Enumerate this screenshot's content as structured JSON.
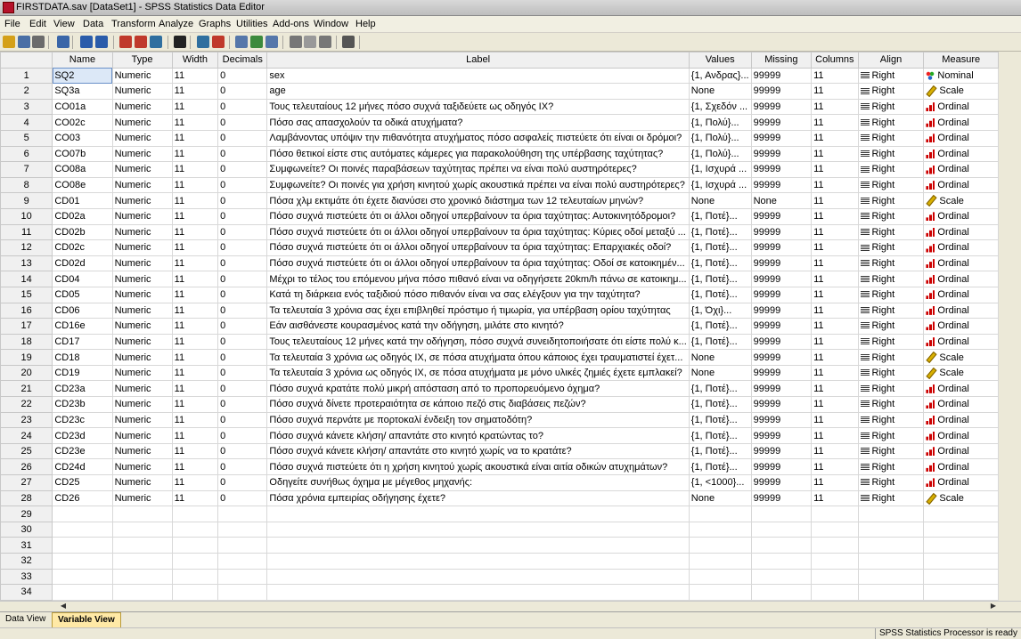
{
  "window": {
    "title": "FIRSTDATA.sav [DataSet1] - SPSS Statistics Data Editor"
  },
  "menu": [
    "File",
    "Edit",
    "View",
    "Data",
    "Transform",
    "Analyze",
    "Graphs",
    "Utilities",
    "Add-ons",
    "Window",
    "Help"
  ],
  "toolbar": [
    "open-icon",
    "save-icon",
    "print-icon",
    "dialog-recall-icon",
    "undo-icon",
    "redo-icon",
    "goto-case-icon",
    "goto-variable-icon",
    "variables-icon",
    "find-icon",
    "insert-cases-icon",
    "insert-variable-icon",
    "split-file-icon",
    "weight-cases-icon",
    "select-cases-icon",
    "value-labels-icon",
    "use-sets-icon",
    "show-all-icon",
    "spell-check-icon"
  ],
  "columns": [
    "Name",
    "Type",
    "Width",
    "Decimals",
    "Label",
    "Values",
    "Missing",
    "Columns",
    "Align",
    "Measure"
  ],
  "rows": [
    [
      "SQ2",
      "Numeric",
      "11",
      "0",
      "sex",
      "{1, Ανδρας}...",
      "99999",
      "11",
      "Right",
      "Nominal"
    ],
    [
      "SQ3a",
      "Numeric",
      "11",
      "0",
      "age",
      "None",
      "99999",
      "11",
      "Right",
      "Scale"
    ],
    [
      "CO01a",
      "Numeric",
      "11",
      "0",
      "Τους τελευταίους 12 μήνες πόσο συχνά ταξιδεύετε ως οδηγός IX?",
      "{1, Σχεδόν ...",
      "99999",
      "11",
      "Right",
      "Ordinal"
    ],
    [
      "CO02c",
      "Numeric",
      "11",
      "0",
      "Πόσο σας απασχολούν τα οδικά ατυχήματα?",
      "{1, Πολύ}...",
      "99999",
      "11",
      "Right",
      "Ordinal"
    ],
    [
      "CO03",
      "Numeric",
      "11",
      "0",
      "Λαμβάνοντας υπόψιν την πιθανότητα ατυχήματος πόσο ασφαλείς πιστεύετε ότι είναι οι δρόμοι?",
      "{1, Πολύ}...",
      "99999",
      "11",
      "Right",
      "Ordinal"
    ],
    [
      "CO07b",
      "Numeric",
      "11",
      "0",
      "Πόσο θετικοί είστε στις αυτόματες κάμερες για παρακολούθηση της υπέρβασης ταχύτητας?",
      "{1, Πολύ}...",
      "99999",
      "11",
      "Right",
      "Ordinal"
    ],
    [
      "CO08a",
      "Numeric",
      "11",
      "0",
      "Συμφωνείτε? Οι ποινές παραβάσεων ταχύτητας πρέπει να είναι πολύ αυστηρότερες?",
      "{1, Ισχυρά ...",
      "99999",
      "11",
      "Right",
      "Ordinal"
    ],
    [
      "CO08e",
      "Numeric",
      "11",
      "0",
      "Συμφωνείτε? Οι ποινές για χρήση κινητού χωρίς ακουστικά πρέπει να είναι πολύ αυστηρότερες?",
      "{1, Ισχυρά ...",
      "99999",
      "11",
      "Right",
      "Ordinal"
    ],
    [
      "CD01",
      "Numeric",
      "11",
      "0",
      "Πόσα χλμ εκτιμάτε ότι έχετε διανύσει στο χρονικό διάστημα των 12 τελευταίων μηνών?",
      "None",
      "None",
      "11",
      "Right",
      "Scale"
    ],
    [
      "CD02a",
      "Numeric",
      "11",
      "0",
      "Πόσο συχνά πιστεύετε ότι οι άλλοι οδηγοί υπερβαίνουν τα όρια ταχύτητας: Αυτοκινητόδρομοι?",
      "{1, Ποτέ}...",
      "99999",
      "11",
      "Right",
      "Ordinal"
    ],
    [
      "CD02b",
      "Numeric",
      "11",
      "0",
      "Πόσο συχνά πιστεύετε ότι οι άλλοι οδηγοί υπερβαίνουν τα όρια ταχύτητας: Κύριες οδοί μεταξύ ...",
      "{1, Ποτέ}...",
      "99999",
      "11",
      "Right",
      "Ordinal"
    ],
    [
      "CD02c",
      "Numeric",
      "11",
      "0",
      "Πόσο συχνά πιστεύετε ότι οι άλλοι οδηγοί υπερβαίνουν τα όρια ταχύτητας: Επαρχιακές οδοί?",
      "{1, Ποτέ}...",
      "99999",
      "11",
      "Right",
      "Ordinal"
    ],
    [
      "CD02d",
      "Numeric",
      "11",
      "0",
      "Πόσο συχνά πιστεύετε ότι οι άλλοι οδηγοί υπερβαίνουν τα όρια ταχύτητας: Οδοί σε κατοικημέν...",
      "{1, Ποτέ}...",
      "99999",
      "11",
      "Right",
      "Ordinal"
    ],
    [
      "CD04",
      "Numeric",
      "11",
      "0",
      "Μέχρι το τέλος του επόμενου μήνα πόσο πιθανό είναι να οδηγήσετε 20km/h πάνω σε κατοικημ...",
      "{1, Ποτέ}...",
      "99999",
      "11",
      "Right",
      "Ordinal"
    ],
    [
      "CD05",
      "Numeric",
      "11",
      "0",
      "Κατά τη διάρκεια ενός ταξιδιού πόσο πιθανόν είναι να σας ελέγξουν για την ταχύτητα?",
      "{1, Ποτέ}...",
      "99999",
      "11",
      "Right",
      "Ordinal"
    ],
    [
      "CD06",
      "Numeric",
      "11",
      "0",
      "Τα τελευταία 3 χρόνια σας έχει επιβληθεί πρόστιμο ή τιμωρία, για υπέρβαση ορίου ταχύτητας",
      "{1, Όχι}...",
      "99999",
      "11",
      "Right",
      "Ordinal"
    ],
    [
      "CD16e",
      "Numeric",
      "11",
      "0",
      "Εάν αισθάνεστε κουρασμένος κατά την  οδήγηση, μιλάτε στο κινητό?",
      "{1, Ποτέ}...",
      "99999",
      "11",
      "Right",
      "Ordinal"
    ],
    [
      "CD17",
      "Numeric",
      "11",
      "0",
      "Τους τελευταίους 12 μήνες κατά την οδήγηση, πόσο συχνά συνειδητοποιήσατε ότι είστε πολύ κ...",
      "{1, Ποτέ}...",
      "99999",
      "11",
      "Right",
      "Ordinal"
    ],
    [
      "CD18",
      "Numeric",
      "11",
      "0",
      "Τα τελευταία 3 χρόνια ως οδηγός IX, σε πόσα ατυχήματα όπου κάποιος έχει τραυματιστεί έχετ...",
      "None",
      "99999",
      "11",
      "Right",
      "Scale"
    ],
    [
      "CD19",
      "Numeric",
      "11",
      "0",
      "Τα τελευταία 3 χρόνια ως οδηγός IX, σε πόσα ατυχήματα με μόνο υλικές ζημιές έχετε εμπλακεί?",
      "None",
      "99999",
      "11",
      "Right",
      "Scale"
    ],
    [
      "CD23a",
      "Numeric",
      "11",
      "0",
      "Πόσο συχνά κρατάτε πολύ μικρή απόσταση από το προπορευόμενο όχημα?",
      "{1, Ποτέ}...",
      "99999",
      "11",
      "Right",
      "Ordinal"
    ],
    [
      "CD23b",
      "Numeric",
      "11",
      "0",
      "Πόσο συχνά δίνετε προτεραιότητα σε κάποιο πεζό στις διαβάσεις πεζών?",
      "{1, Ποτέ}...",
      "99999",
      "11",
      "Right",
      "Ordinal"
    ],
    [
      "CD23c",
      "Numeric",
      "11",
      "0",
      "Πόσο συχνά περνάτε με πορτοκαλί ένδειξη τον σηματοδότη?",
      "{1, Ποτέ}...",
      "99999",
      "11",
      "Right",
      "Ordinal"
    ],
    [
      "CD23d",
      "Numeric",
      "11",
      "0",
      "Πόσο συχνά κάνετε κλήση/ απαντάτε στο κινητό  κρατώντας το?",
      "{1, Ποτέ}...",
      "99999",
      "11",
      "Right",
      "Ordinal"
    ],
    [
      "CD23e",
      "Numeric",
      "11",
      "0",
      "Πόσο συχνά κάνετε κλήση/ απαντάτε στο κινητό χωρίς να το κρατάτε?",
      "{1, Ποτέ}...",
      "99999",
      "11",
      "Right",
      "Ordinal"
    ],
    [
      "CD24d",
      "Numeric",
      "11",
      "0",
      "Πόσο συχνά πιστεύετε ότι η χρήση κινητού χωρίς ακουστικά είναι αιτία οδικών ατυχημάτων?",
      "{1, Ποτέ}...",
      "99999",
      "11",
      "Right",
      "Ordinal"
    ],
    [
      "CD25",
      "Numeric",
      "11",
      "0",
      "Οδηγείτε συνήθως όχημα με μέγεθος μηχανής:",
      "{1, <1000}...",
      "99999",
      "11",
      "Right",
      "Ordinal"
    ],
    [
      "CD26",
      "Numeric",
      "11",
      "0",
      "Πόσα χρόνια εμπειρίας οδήγησης έχετε?",
      "None",
      "99999",
      "11",
      "Right",
      "Scale"
    ]
  ],
  "empty_rows": [
    "29",
    "30",
    "31",
    "32",
    "33",
    "34"
  ],
  "tabs": {
    "data_view": "Data View",
    "variable_view": "Variable View"
  },
  "status": {
    "text": "SPSS Statistics  Processor is ready"
  },
  "colors": {
    "selected_cell": "#dce8f7",
    "active_tab": "#ffe9a6"
  }
}
